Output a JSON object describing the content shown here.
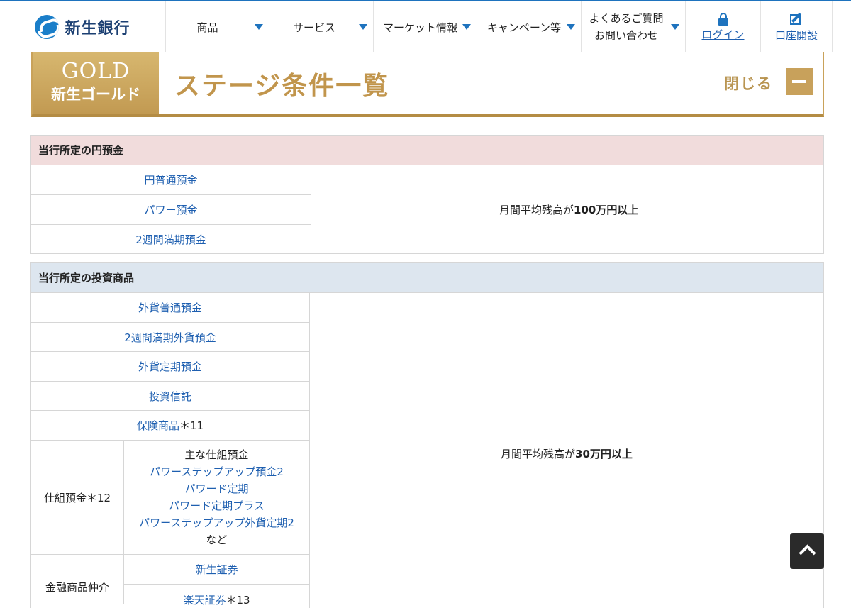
{
  "header": {
    "logo_text": "新生銀行",
    "nav": [
      {
        "label": "商品"
      },
      {
        "label": "サービス"
      },
      {
        "label": "マーケット情報"
      },
      {
        "label": "キャンペーン等"
      }
    ],
    "faq_line1": "よくあるご質問",
    "faq_line2": "お問い合わせ",
    "login": "ログイン",
    "open_account": "口座開設"
  },
  "banner": {
    "badge_title": "GOLD",
    "badge_sub": "新生ゴールド",
    "title": "ステージ条件一覧",
    "close_label": "閉じる"
  },
  "yen_section": {
    "title": "当行所定の円預金",
    "items": [
      "円普通預金",
      "パワー預金",
      "2週間満期預金"
    ],
    "condition_prefix": "月間平均残高が",
    "condition_bold": "100万円以上"
  },
  "invest_section": {
    "title": "当行所定の投資商品",
    "items": [
      "外貨普通預金",
      "2週間満期外貨預金",
      "外貨定期預金",
      "投資信託"
    ],
    "insurance": "保険商品",
    "insurance_note": "＊11",
    "structured_label": "仕組預金＊12",
    "structured_intro": "主な仕組預金",
    "structured_items": [
      "パワーステップアップ預金2",
      "パワード定期",
      "パワード定期プラス",
      "パワーステップアップ外貨定期2"
    ],
    "structured_etc": "など",
    "brokerage_label": "金融商品仲介",
    "brokerage_items": [
      "新生証券",
      "楽天証券"
    ],
    "rakuten_note": "＊13",
    "condition_prefix": "月間平均残高が",
    "condition_bold": "30万円以上"
  }
}
